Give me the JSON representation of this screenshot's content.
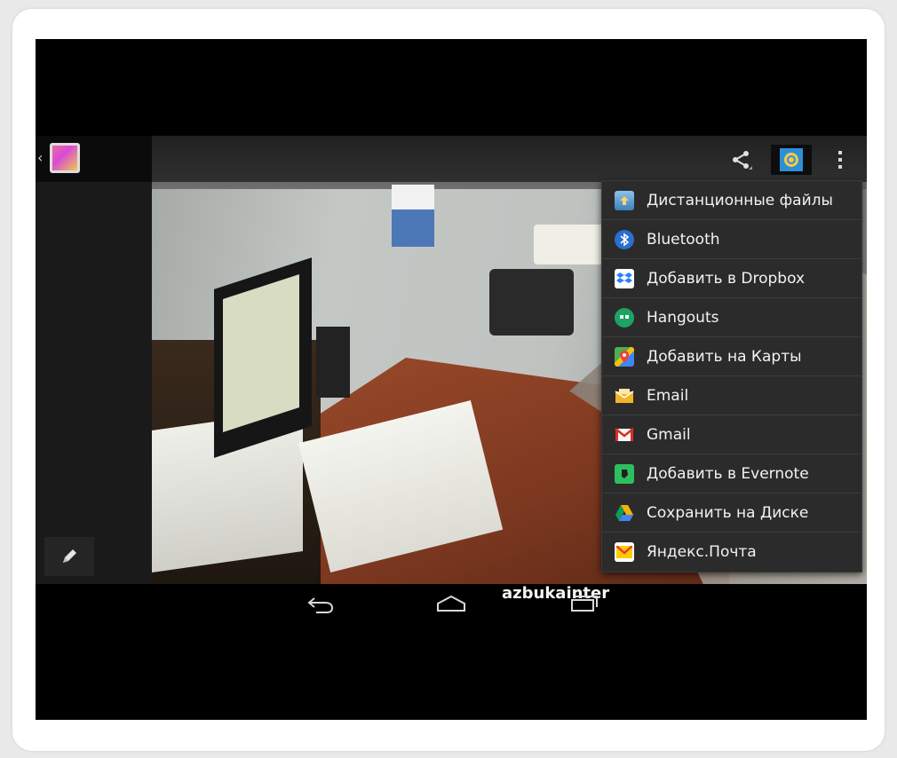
{
  "photo": {
    "watermark": "azbukainter"
  },
  "action_bar": {
    "icons": {
      "up": "chevron-left-icon",
      "app": "gallery-app-icon",
      "share": "share-icon",
      "email_quick_share": "email-at-icon",
      "overflow": "overflow-menu-icon"
    }
  },
  "share_menu": {
    "items": [
      {
        "label": "Дистанционные файлы",
        "icon": "remote-files-icon",
        "color": "#4a90c8"
      },
      {
        "label": "Bluetooth",
        "icon": "bluetooth-icon",
        "color": "#2a6fd1"
      },
      {
        "label": "Добавить в Dropbox",
        "icon": "dropbox-icon",
        "color": "#2d7ff9"
      },
      {
        "label": "Hangouts",
        "icon": "hangouts-icon",
        "color": "#1ea362"
      },
      {
        "label": "Добавить на Карты",
        "icon": "maps-icon",
        "color": "#e8453c"
      },
      {
        "label": "Email",
        "icon": "email-icon",
        "color": "#f0b429"
      },
      {
        "label": "Gmail",
        "icon": "gmail-icon",
        "color": "#d93025"
      },
      {
        "label": "Добавить в Evernote",
        "icon": "evernote-icon",
        "color": "#2dbe60"
      },
      {
        "label": "Сохранить на Диске",
        "icon": "drive-icon",
        "color": "#f4b400"
      },
      {
        "label": "Яндекс.Почта",
        "icon": "yandex-mail-icon",
        "color": "#ffcc00"
      }
    ]
  },
  "nav_bar": {
    "back": "back-icon",
    "home": "home-icon",
    "recents": "recents-icon"
  },
  "edit": {
    "icon": "pencil-icon"
  }
}
